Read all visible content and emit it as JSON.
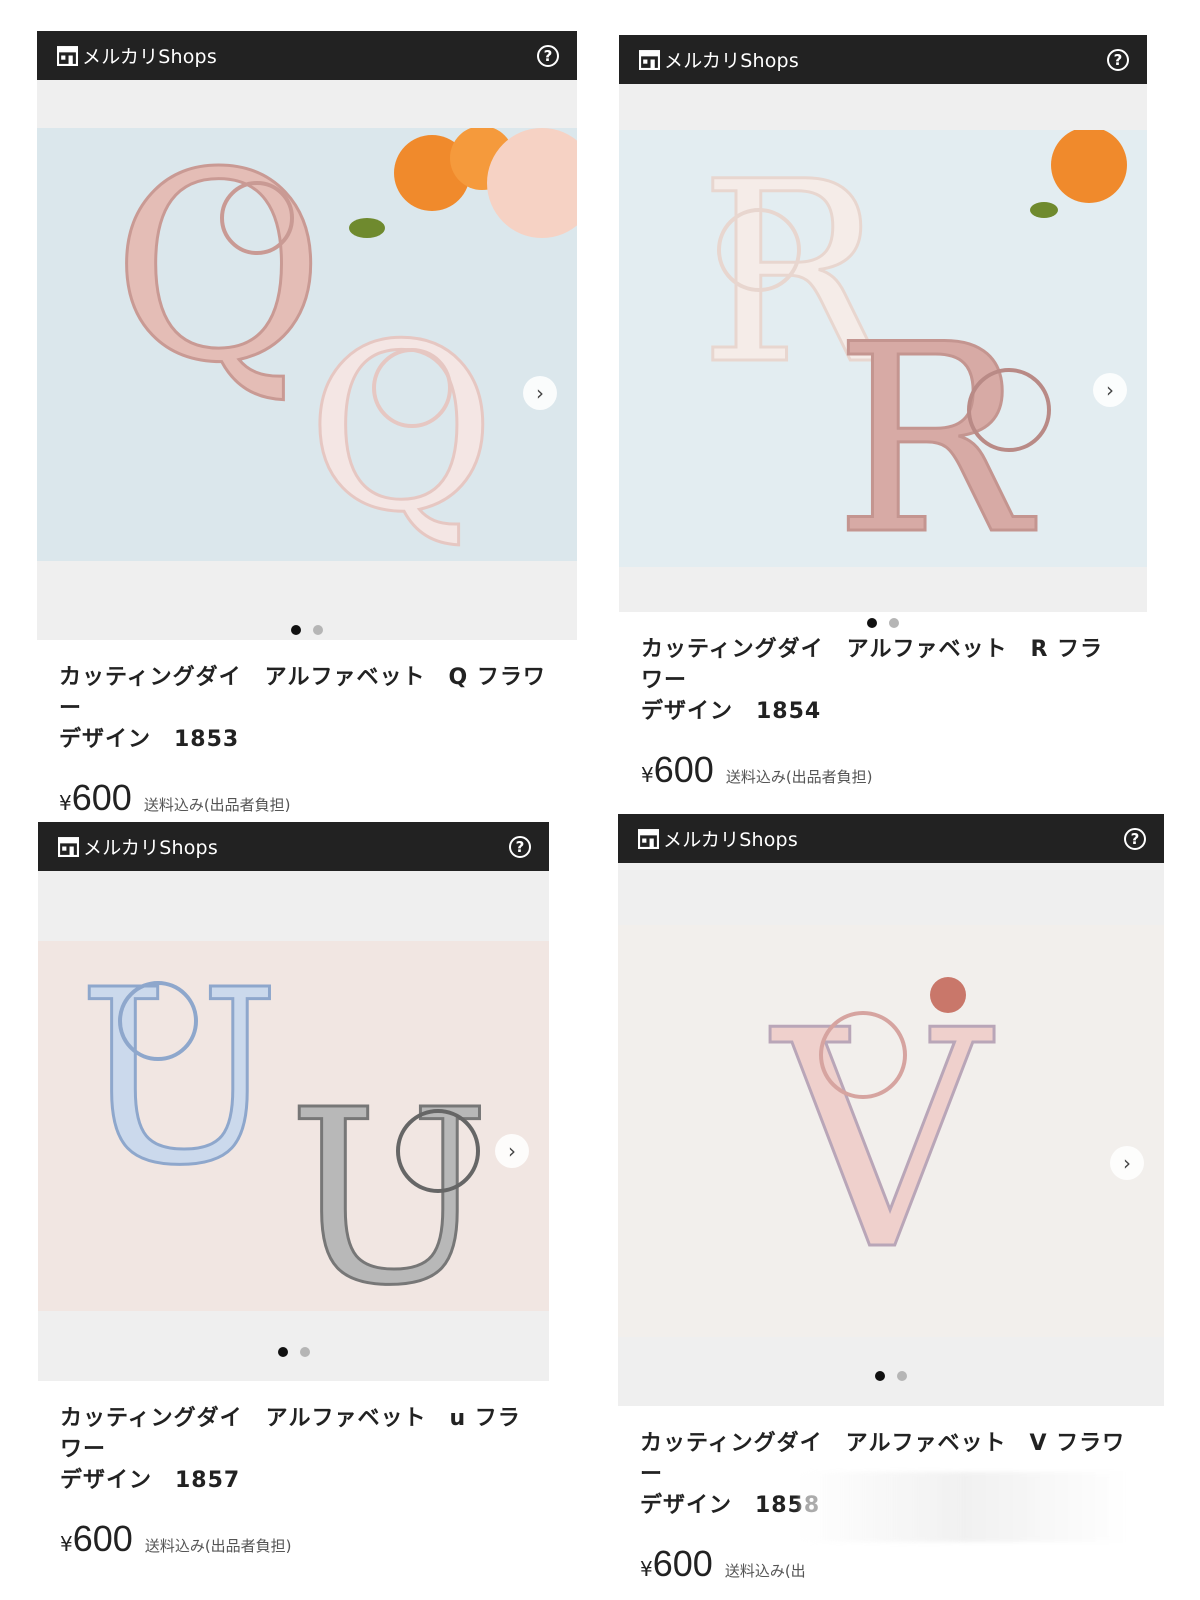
{
  "cards": [
    {
      "shop_name": "メルカリShops",
      "title_line1": "カッティングダイ　アルファベット　Q フラワー",
      "title_line2": "デザイン　1853",
      "currency": "¥",
      "price": "600",
      "shipping": "送料込み(出品者負担)",
      "letter": "Q"
    },
    {
      "shop_name": "メルカリShops",
      "title_line1": "カッティングダイ　アルファベット　R フラワー",
      "title_line2": "デザイン　1854",
      "currency": "¥",
      "price": "600",
      "shipping": "送料込み(出品者負担)",
      "letter": "R"
    },
    {
      "shop_name": "メルカリShops",
      "title_line1": "カッティングダイ　アルファベット　u フラワー",
      "title_line2": "デザイン　1857",
      "currency": "¥",
      "price": "600",
      "shipping": "送料込み(出品者負担)",
      "letter": "U"
    },
    {
      "shop_name": "メルカリShops",
      "title_line1": "カッティングダイ　アルファベット　V フラワー",
      "title_line2": "デザイン　1858",
      "currency": "¥",
      "price": "600",
      "shipping": "送料込み(出",
      "letter": "V"
    }
  ],
  "icons": {
    "store": "store-icon",
    "help": "help-circle-icon",
    "next": "chevron-right-icon"
  },
  "colors": {
    "shop_bar": "#222222",
    "gallery_bg": "#efefef",
    "active_dot": "#111111",
    "inactive_dot": "#b5b5b5"
  }
}
